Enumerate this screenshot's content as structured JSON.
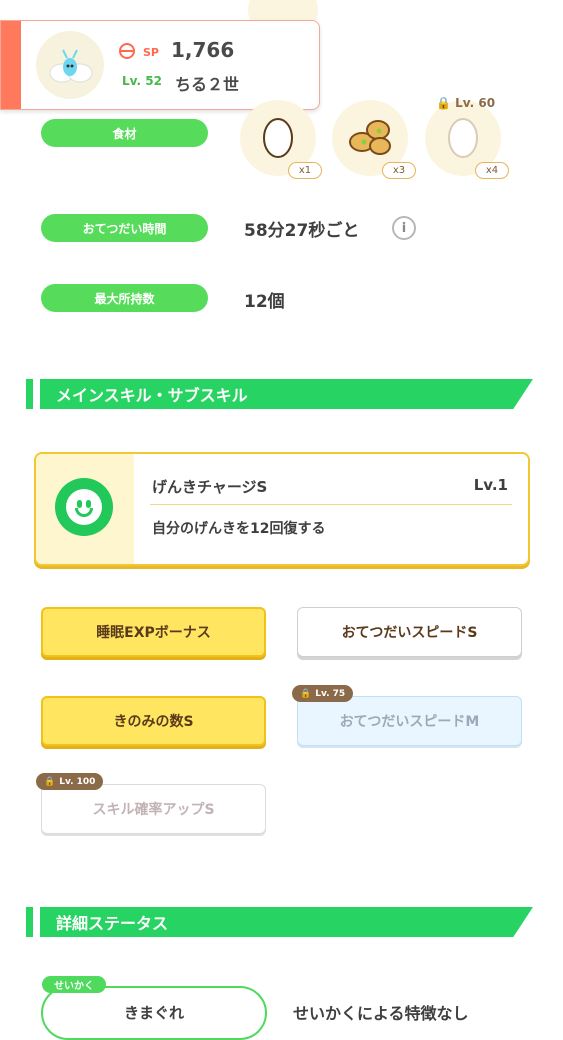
{
  "header": {
    "sp_label": "SP",
    "sp_value": "1,766",
    "level": "Lv. 52",
    "name": "ちる２世"
  },
  "stats": {
    "ingredients_label": "食材",
    "help_time_label": "おてつだい時間",
    "help_time_value": "58分27秒ごと",
    "max_carry_label": "最大所持数",
    "max_carry_value": "12個",
    "ingredients": [
      {
        "icon": "egg-icon",
        "count": "x1"
      },
      {
        "icon": "soybeans-icon",
        "count": "x3"
      },
      {
        "icon": "egg-icon",
        "count": "x4",
        "lock": "Lv. 60"
      }
    ]
  },
  "skills_section": {
    "title": "メインスキル・サブスキル",
    "main_skill": {
      "name": "げんきチャージS",
      "level": "Lv.1",
      "description": "自分のげんきを12回復する"
    },
    "sub_skills": [
      {
        "label": "睡眠EXPボーナス"
      },
      {
        "label": "おてつだいスピードS"
      },
      {
        "label": "きのみの数S"
      },
      {
        "label": "おてつだいスピードM",
        "lock": "Lv. 75"
      },
      {
        "label": "スキル確率アップS",
        "lock": "Lv. 100"
      }
    ]
  },
  "details_section": {
    "title": "詳細ステータス",
    "nature_tag": "せいかく",
    "nature_value": "きまぐれ",
    "nature_desc": "せいかくによる特徴なし"
  },
  "colors": {
    "accent_green": "#56dc5a",
    "section_green": "#27d463",
    "header_accent": "#ff7a5c",
    "skill_yellow": "#ffe560"
  }
}
